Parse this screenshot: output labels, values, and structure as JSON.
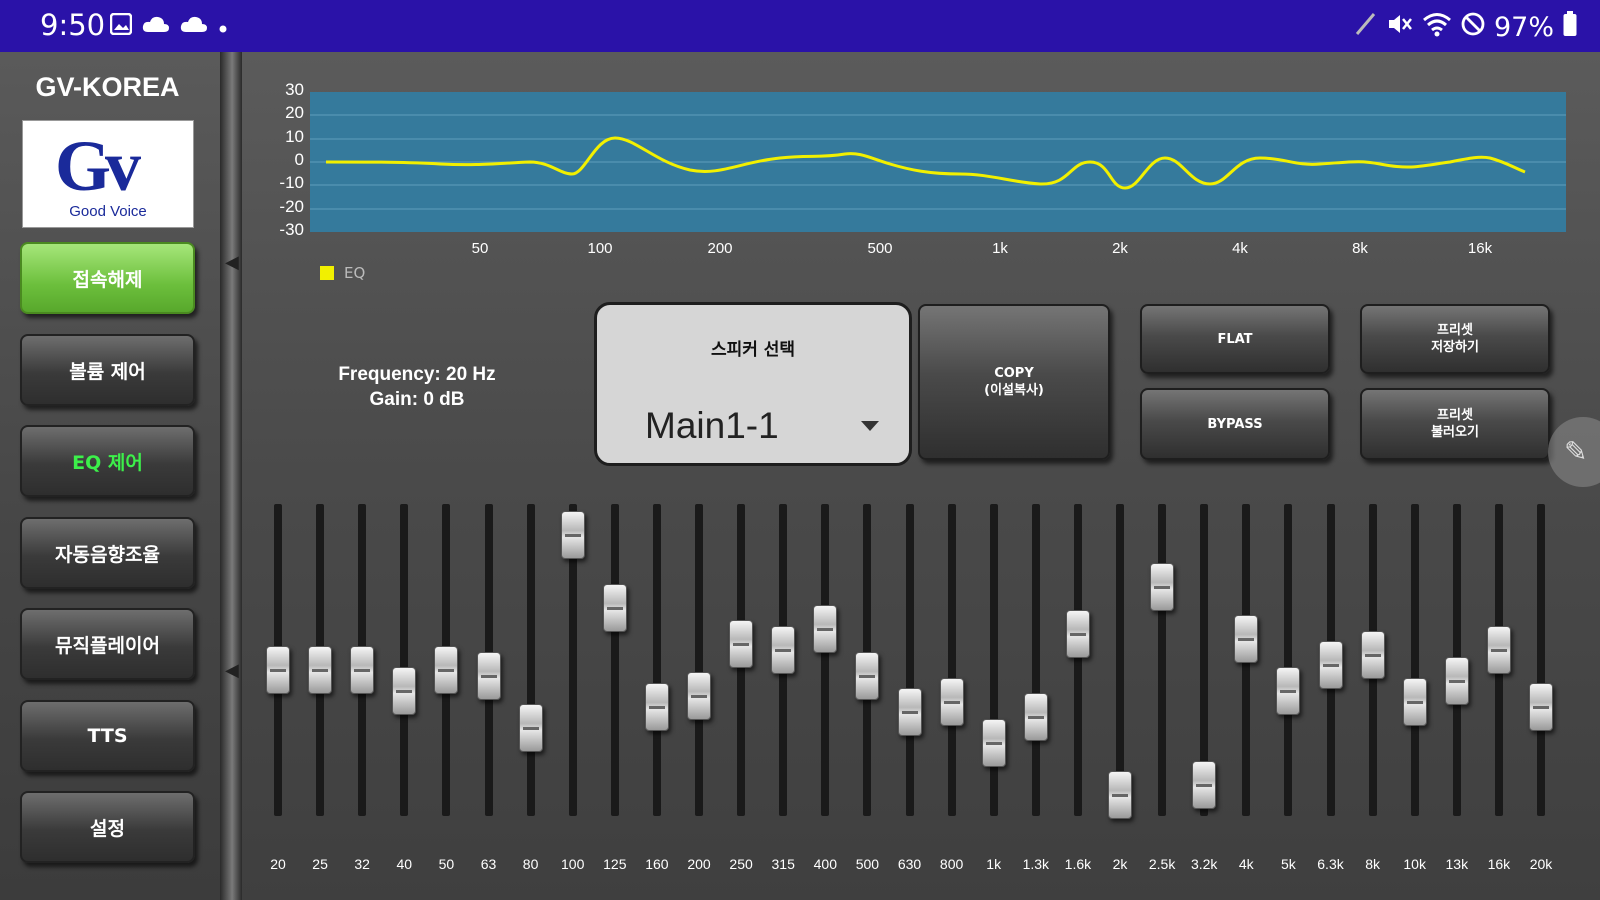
{
  "status_bar": {
    "time": "9:50",
    "left_icons": [
      "gallery-icon",
      "cloud-icon",
      "cloud-icon",
      "dot-icon"
    ],
    "right_icons": [
      "pen-icon",
      "mute-icon",
      "wifi-icon",
      "do-not-disturb-icon"
    ],
    "battery": "97%"
  },
  "sidebar": {
    "brand": "GV-KOREA",
    "logo_text": "Gv",
    "logo_caption": "Good Voice",
    "items": [
      {
        "label": "접속해제",
        "state": "connected"
      },
      {
        "label": "볼륨 제어",
        "state": "normal"
      },
      {
        "label": "EQ 제어",
        "state": "active"
      },
      {
        "label": "자동음향조율",
        "state": "normal"
      },
      {
        "label": "뮤직플레이어",
        "state": "normal"
      },
      {
        "label": "TTS",
        "state": "normal"
      },
      {
        "label": "설정",
        "state": "normal"
      }
    ]
  },
  "eq_graph": {
    "y_ticks": [
      "30",
      "20",
      "10",
      "0",
      "-10",
      "-20",
      "-30"
    ],
    "x_ticks": [
      "50",
      "100",
      "200",
      "500",
      "1k",
      "2k",
      "4k",
      "8k",
      "16k"
    ],
    "legend": "EQ",
    "line_color": "#f2f000",
    "bg_color": "#357a9c"
  },
  "readout": {
    "frequency": "Frequency: 20 Hz",
    "gain": "Gain: 0 dB"
  },
  "speaker_select": {
    "title": "스피커 선택",
    "value": "Main1-1"
  },
  "actions": {
    "copy_line1": "COPY",
    "copy_line2": "(이설복사)",
    "flat": "FLAT",
    "bypass": "BYPASS",
    "preset_save_line1": "프리셋",
    "preset_save_line2": "저장하기",
    "preset_load_line1": "프리셋",
    "preset_load_line2": "불러오기"
  },
  "bands": [
    {
      "freq": "20",
      "gain": -1
    },
    {
      "freq": "25",
      "gain": -1
    },
    {
      "freq": "32",
      "gain": -1
    },
    {
      "freq": "40",
      "gain": -3
    },
    {
      "freq": "50",
      "gain": -1
    },
    {
      "freq": "63",
      "gain": -1.5
    },
    {
      "freq": "80",
      "gain": -6.5
    },
    {
      "freq": "100",
      "gain": 12
    },
    {
      "freq": "125",
      "gain": 5
    },
    {
      "freq": "160",
      "gain": -4.5
    },
    {
      "freq": "200",
      "gain": -3.5
    },
    {
      "freq": "250",
      "gain": 1.5
    },
    {
      "freq": "315",
      "gain": 1
    },
    {
      "freq": "400",
      "gain": 3
    },
    {
      "freq": "500",
      "gain": -1.5
    },
    {
      "freq": "630",
      "gain": -5
    },
    {
      "freq": "800",
      "gain": -4
    },
    {
      "freq": "1k",
      "gain": -8
    },
    {
      "freq": "1.3k",
      "gain": -5.5
    },
    {
      "freq": "1.6k",
      "gain": 2.5
    },
    {
      "freq": "2k",
      "gain": -13
    },
    {
      "freq": "2.5k",
      "gain": 7
    },
    {
      "freq": "3.2k",
      "gain": -12
    },
    {
      "freq": "4k",
      "gain": 2
    },
    {
      "freq": "5k",
      "gain": -3
    },
    {
      "freq": "6.3k",
      "gain": -0.5
    },
    {
      "freq": "8k",
      "gain": 0.5
    },
    {
      "freq": "10k",
      "gain": -4
    },
    {
      "freq": "13k",
      "gain": -2
    },
    {
      "freq": "16k",
      "gain": 1
    },
    {
      "freq": "20k",
      "gain": -4.5
    }
  ]
}
